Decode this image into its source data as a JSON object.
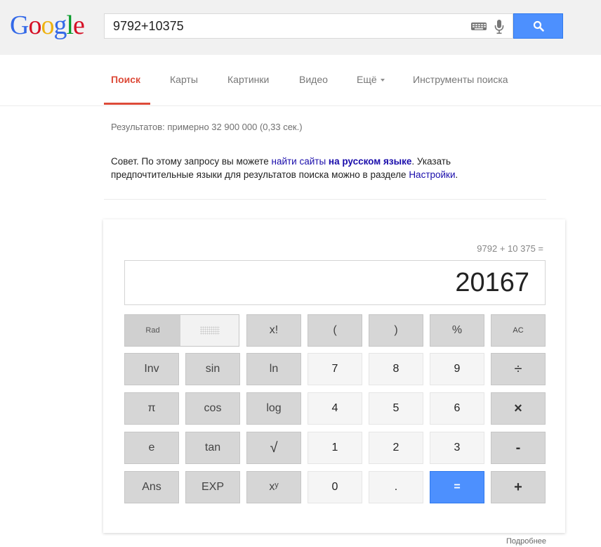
{
  "header": {
    "logo_letters": [
      {
        "ch": "G",
        "color": "#3369e8"
      },
      {
        "ch": "o",
        "color": "#d50f25"
      },
      {
        "ch": "o",
        "color": "#eeb211"
      },
      {
        "ch": "g",
        "color": "#3369e8"
      },
      {
        "ch": "l",
        "color": "#009925"
      },
      {
        "ch": "e",
        "color": "#d50f25"
      }
    ],
    "search_query": "9792+10375",
    "icons": [
      "keyboard-icon",
      "mic-icon",
      "search-icon"
    ]
  },
  "tabs": {
    "items": [
      "Поиск",
      "Карты",
      "Картинки",
      "Видео",
      "Ещё",
      "Инструменты поиска"
    ],
    "active": "Поиск"
  },
  "results_stats": "Результатов: примерно 32 900 000 (0,33 сек.)",
  "tip": {
    "part1": "Совет. По этому запросу вы можете ",
    "link1": "найти сайты",
    "space": " ",
    "link2": "на русском языке",
    "part2": ". Указать предпочтительные языки для результатов поиска можно в разделе ",
    "link3": "Настройки",
    "part3": "."
  },
  "calculator": {
    "expression": "9792 + 10 375 =",
    "result": "20167",
    "keys": {
      "rad": "Rad",
      "fact": "x!",
      "lparen": "(",
      "rparen": ")",
      "percent": "%",
      "ac": "AC",
      "inv": "Inv",
      "sin": "sin",
      "ln": "ln",
      "seven": "7",
      "eight": "8",
      "nine": "9",
      "divide": "÷",
      "pi": "π",
      "cos": "cos",
      "log": "log",
      "four": "4",
      "five": "5",
      "six": "6",
      "multiply": "×",
      "e": "e",
      "tan": "tan",
      "sqrt": "√",
      "one": "1",
      "two": "2",
      "three": "3",
      "minus": "-",
      "ans": "Ans",
      "exp": "EXP",
      "power": "xʸ",
      "zero": "0",
      "dot": ".",
      "equals": "=",
      "plus": "+"
    },
    "accent_color": "#4d90fe"
  },
  "more_link": "Подробнее"
}
